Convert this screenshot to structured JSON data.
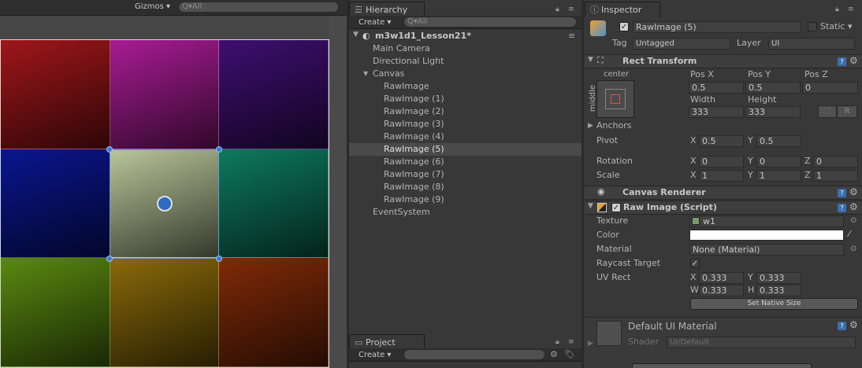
{
  "scene": {
    "gizmos_label": "Gizmos ▾",
    "search_placeholder": "Q▾All",
    "tiles": [
      "#a0161a",
      "#a81c94",
      "#3e0f70",
      "#0a1690",
      "#b9c69a",
      "#0d7a5e",
      "#5a8a10",
      "#8a6a0a",
      "#802a08"
    ]
  },
  "hierarchy": {
    "tab_label": "Hierarchy",
    "create_label": "Create ▾",
    "search_placeholder": "Q▾All",
    "scene_name": "m3w1d1_Lesson21*",
    "items": [
      {
        "label": "Main Camera",
        "indent": 0
      },
      {
        "label": "Directional Light",
        "indent": 0
      },
      {
        "label": "Canvas",
        "indent": 0,
        "expanded": true
      },
      {
        "label": "RawImage",
        "indent": 1
      },
      {
        "label": "RawImage (1)",
        "indent": 1
      },
      {
        "label": "RawImage (2)",
        "indent": 1
      },
      {
        "label": "RawImage (3)",
        "indent": 1
      },
      {
        "label": "RawImage (4)",
        "indent": 1
      },
      {
        "label": "RawImage (5)",
        "indent": 1,
        "selected": true
      },
      {
        "label": "RawImage (6)",
        "indent": 1
      },
      {
        "label": "RawImage (7)",
        "indent": 1
      },
      {
        "label": "RawImage (8)",
        "indent": 1
      },
      {
        "label": "RawImage (9)",
        "indent": 1
      },
      {
        "label": "EventSystem",
        "indent": 0
      }
    ]
  },
  "project": {
    "tab_label": "Project",
    "create_label": "Create ▾"
  },
  "inspector": {
    "tab_label": "Inspector",
    "object_name": "RawImage (5)",
    "static_label": "Static ▾",
    "tag_label": "Tag",
    "tag_value": "Untagged",
    "layer_label": "Layer",
    "layer_value": "UI",
    "rect_transform": {
      "title": "Rect Transform",
      "anchor_top": "center",
      "anchor_side": "middle",
      "pos_x_label": "Pos X",
      "pos_y_label": "Pos Y",
      "pos_z_label": "Pos Z",
      "pos_x": "0.5",
      "pos_y": "0.5",
      "pos_z": "0",
      "width_label": "Width",
      "height_label": "Height",
      "width": "333",
      "height": "333",
      "r_button": "R",
      "anchors_label": "Anchors",
      "pivot_label": "Pivot",
      "pivot_x": "0.5",
      "pivot_y": "0.5",
      "rotation_label": "Rotation",
      "rotation_x": "0",
      "rotation_y": "0",
      "rotation_z": "0",
      "scale_label": "Scale",
      "scale_x": "1",
      "scale_y": "1",
      "scale_z": "1",
      "x_axis": "X",
      "y_axis": "Y",
      "z_axis": "Z"
    },
    "canvas_renderer": {
      "title": "Canvas Renderer"
    },
    "raw_image": {
      "title": "Raw Image (Script)",
      "texture_label": "Texture",
      "texture_value": "w1",
      "color_label": "Color",
      "material_label": "Material",
      "material_value": "None (Material)",
      "raycast_label": "Raycast Target",
      "uv_rect_label": "UV Rect",
      "uv_x": "0.333",
      "uv_y": "0.333",
      "uv_w": "0.333",
      "uv_h": "0.333",
      "w_axis": "W",
      "h_axis": "H",
      "set_native_size": "Set Native Size"
    },
    "material": {
      "name": "Default UI Material",
      "shader_label": "Shader",
      "shader_value": "UI/Default"
    }
  }
}
